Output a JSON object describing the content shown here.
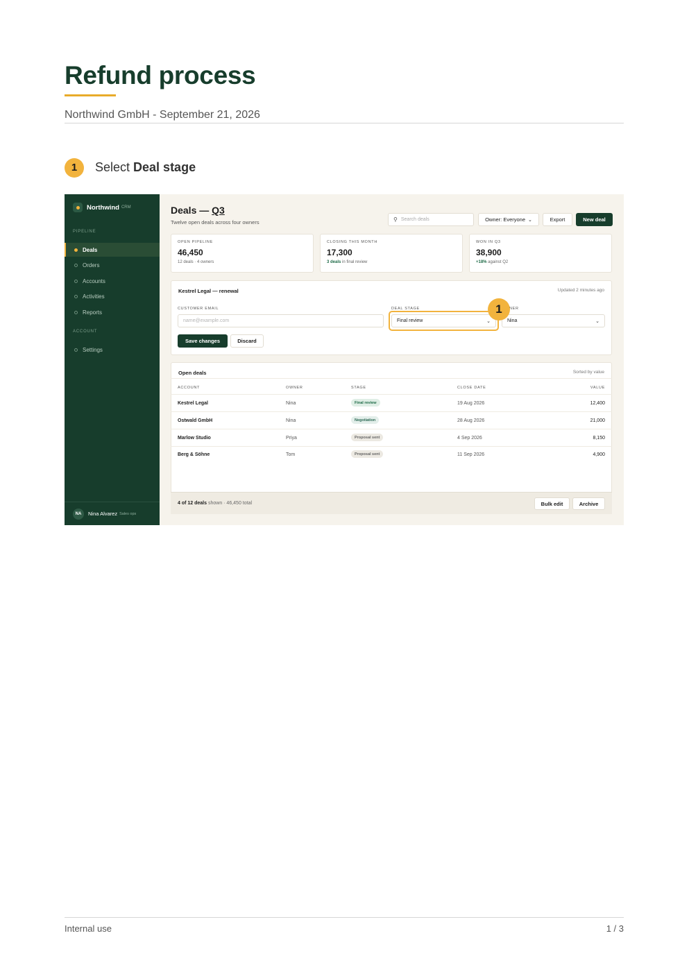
{
  "document": {
    "title": "Refund process",
    "subtitle": "Northwind GmbH - September 21, 2026",
    "footer_left": "Internal use",
    "footer_right": "1 / 3",
    "accent_color": "#e8ab2a",
    "title_color": "#173d2c"
  },
  "step": {
    "number": "1",
    "prefix": "Select ",
    "target": "Deal stage"
  },
  "app": {
    "brand": {
      "name": "Northwind",
      "tag": "CRM"
    },
    "sidebar": {
      "section_pipeline": "PIPELINE",
      "section_account": "ACCOUNT",
      "items": [
        {
          "label": "Deals",
          "active": true
        },
        {
          "label": "Orders"
        },
        {
          "label": "Accounts"
        },
        {
          "label": "Activities"
        },
        {
          "label": "Reports"
        }
      ],
      "account_items": [
        {
          "label": "Settings"
        }
      ],
      "user": {
        "initials": "NA",
        "name": "Nina Alvarez",
        "role": "Sales ops"
      }
    },
    "header": {
      "title_prefix": "Deals — ",
      "title_period": "Q3",
      "subtitle": "Twelve open deals across four owners",
      "search_placeholder": "Search deals",
      "owner_filter": "Owner: Everyone",
      "export_label": "Export",
      "new_deal_label": "New deal"
    },
    "stats": [
      {
        "label": "OPEN PIPELINE",
        "value": "46,450",
        "note": "12 deals · 4 owners",
        "note_emphasis": ""
      },
      {
        "label": "CLOSING THIS MONTH",
        "value": "17,300",
        "note_emphasis": "3 deals",
        "note": " in final review"
      },
      {
        "label": "WON IN Q3",
        "value": "38,900",
        "note_emphasis": "+18%",
        "note": " against Q2"
      }
    ],
    "edit_form": {
      "title": "Kestrel Legal — renewal",
      "updated": "Updated 2 minutes ago",
      "email_label": "CUSTOMER EMAIL",
      "email_placeholder": "name@example.com",
      "stage_label": "DEAL STAGE",
      "stage_value": "Final review",
      "owner_label": "NER",
      "owner_value": "Nina",
      "save_label": "Save changes",
      "discard_label": "Discard",
      "marker": "1"
    },
    "table": {
      "title": "Open deals",
      "sort_note": "Sorted by value",
      "columns": [
        "ACCOUNT",
        "OWNER",
        "STAGE",
        "CLOSE DATE",
        "VALUE"
      ],
      "rows": [
        {
          "account": "Kestrel Legal",
          "owner": "Nina",
          "stage": "Final review",
          "close": "19 Aug 2026",
          "value": "12,400"
        },
        {
          "account": "Ostwald GmbH",
          "owner": "Nina",
          "stage": "Negotiation",
          "close": "28 Aug 2026",
          "value": "21,000"
        },
        {
          "account": "Marlow Studio",
          "owner": "Priya",
          "stage": "Proposal sent",
          "close": "4 Sep 2026",
          "value": "8,150"
        },
        {
          "account": "Berg & Söhne",
          "owner": "Tom",
          "stage": "Proposal sent",
          "close": "11 Sep 2026",
          "value": "4,900"
        }
      ],
      "footer_count": "4 of 12 deals",
      "footer_rest": " shown · 46,450 total",
      "bulk_edit_label": "Bulk edit",
      "archive_label": "Archive"
    }
  }
}
